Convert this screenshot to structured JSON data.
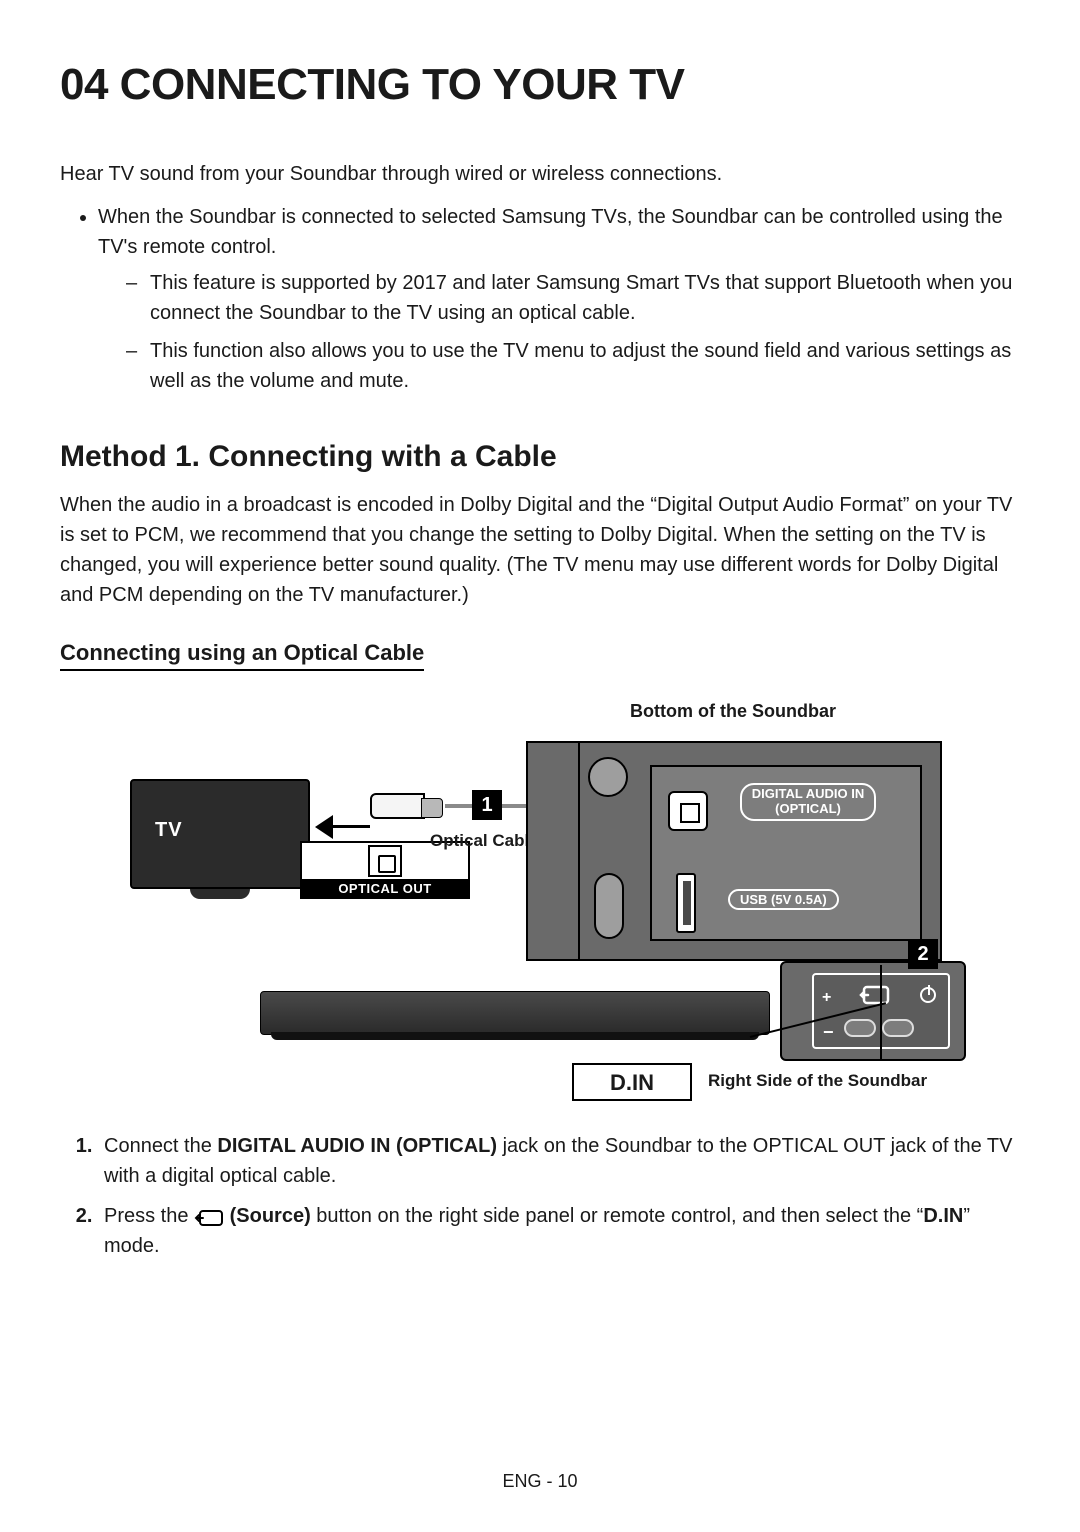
{
  "chapter": "04  CONNECTING TO YOUR TV",
  "intro": "Hear TV sound from your Soundbar through wired or wireless connections.",
  "bullet1": "When the Soundbar is connected to selected Samsung TVs, the Soundbar can be controlled using the TV's remote control.",
  "sub1": "This feature is supported by 2017 and later Samsung Smart TVs that support Bluetooth when you connect the Soundbar to the TV using an optical cable.",
  "sub2": "This function also allows you to use the TV menu to adjust the sound field and various settings as well as the volume and mute.",
  "method_heading": "Method 1. Connecting with a Cable",
  "method_desc": "When the audio in a broadcast is encoded in Dolby Digital and the “Digital Output Audio Format” on your TV is set to PCM, we recommend that you change the setting to Dolby Digital. When the setting on the TV is changed, you will experience better sound quality. (The TV menu may use different words for Dolby Digital and PCM depending on the TV manufacturer.)",
  "subsection": "Connecting using an Optical Cable",
  "diagram": {
    "top_label": "Bottom of the Soundbar",
    "tv_label": "TV",
    "optical_out": "OPTICAL OUT",
    "optical_cable": "Optical Cable",
    "digital_audio_in_line1": "DIGITAL AUDIO IN",
    "digital_audio_in_line2": "(OPTICAL)",
    "usb_label": "USB (5V 0.5A)",
    "din": "D.IN",
    "right_side": "Right Side of the Soundbar",
    "badge1": "1",
    "badge2": "2"
  },
  "step1_a": "Connect the ",
  "step1_b": "DIGITAL AUDIO IN (OPTICAL)",
  "step1_c": " jack on the Soundbar to the OPTICAL OUT jack of the TV with a digital optical cable.",
  "step2_a": "Press the ",
  "step2_b": " (Source)",
  "step2_c": " button on the right side panel or remote control, and then select the “",
  "step2_d": "D.IN",
  "step2_e": "” mode.",
  "footer": "ENG - 10"
}
